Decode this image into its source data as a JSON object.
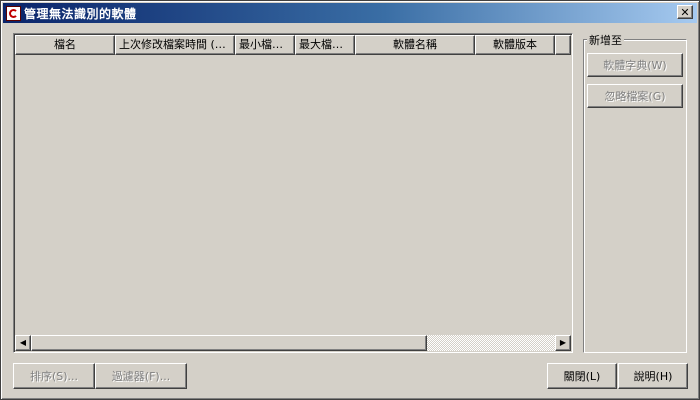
{
  "window": {
    "title": "管理無法識別的軟體",
    "close_label": "✕"
  },
  "table": {
    "columns": [
      {
        "label": "檔名"
      },
      {
        "label": "上次修改檔案時間 (U..."
      },
      {
        "label": "最小檔案..."
      },
      {
        "label": "最大檔案..."
      },
      {
        "label": "軟體名稱"
      },
      {
        "label": "軟體版本"
      },
      {
        "label": ""
      }
    ],
    "rows": []
  },
  "add_to": {
    "title": "新增至",
    "software_dictionary_label": "軟體字典(W)",
    "ignore_files_label": "忽略檔案(G)"
  },
  "footer": {
    "sort_label": "排序(S)...",
    "filter_label": "過濾器(F)...",
    "close_label": "關閉(L)",
    "help_label": "說明(H)"
  }
}
